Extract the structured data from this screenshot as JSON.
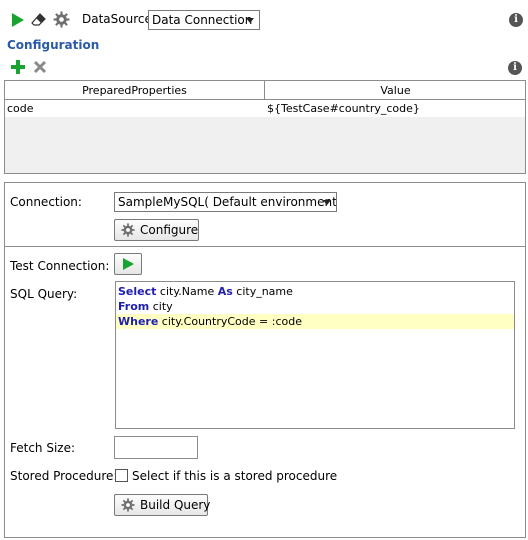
{
  "toolbar": {
    "datasource_label": "DataSource:",
    "datasource_value": "Data Connection",
    "icons": [
      "play-icon",
      "eraser-icon",
      "gear-icon",
      "info-icon"
    ]
  },
  "configuration": {
    "title": "Configuration",
    "icons": [
      "add-icon",
      "remove-icon",
      "info-icon"
    ]
  },
  "properties_table": {
    "columns": [
      "PreparedProperties",
      "Value"
    ],
    "rows": [
      {
        "name": "code",
        "value": "${TestCase#country_code}"
      }
    ]
  },
  "connection": {
    "label": "Connection:",
    "value": "SampleMySQL( Default environment )",
    "configure_label": "Configure"
  },
  "test_connection": {
    "label": "Test Connection:"
  },
  "sql_query": {
    "label": "SQL Query:",
    "lines": [
      {
        "kw": "Select",
        "text": " city.Name ",
        "kw2": "As",
        "text2": " city_name"
      },
      {
        "kw": "From",
        "text": " city",
        "kw2": "",
        "text2": ""
      },
      {
        "kw": "Where",
        "text": " city.CountryCode = :code",
        "kw2": "",
        "text2": ""
      }
    ]
  },
  "fetch_size": {
    "label": "Fetch Size:",
    "value": ""
  },
  "stored_procedure": {
    "label": "Stored Procedure:",
    "checkbox_label": "Select if this is a stored procedure",
    "checked": false
  },
  "build_query": {
    "label": "Build Query"
  },
  "colors": {
    "accent_green": "#18a431",
    "title_blue": "#2a5aa8",
    "keyword_blue": "#2020b0",
    "highlight_yellow": "#ffffc4"
  }
}
